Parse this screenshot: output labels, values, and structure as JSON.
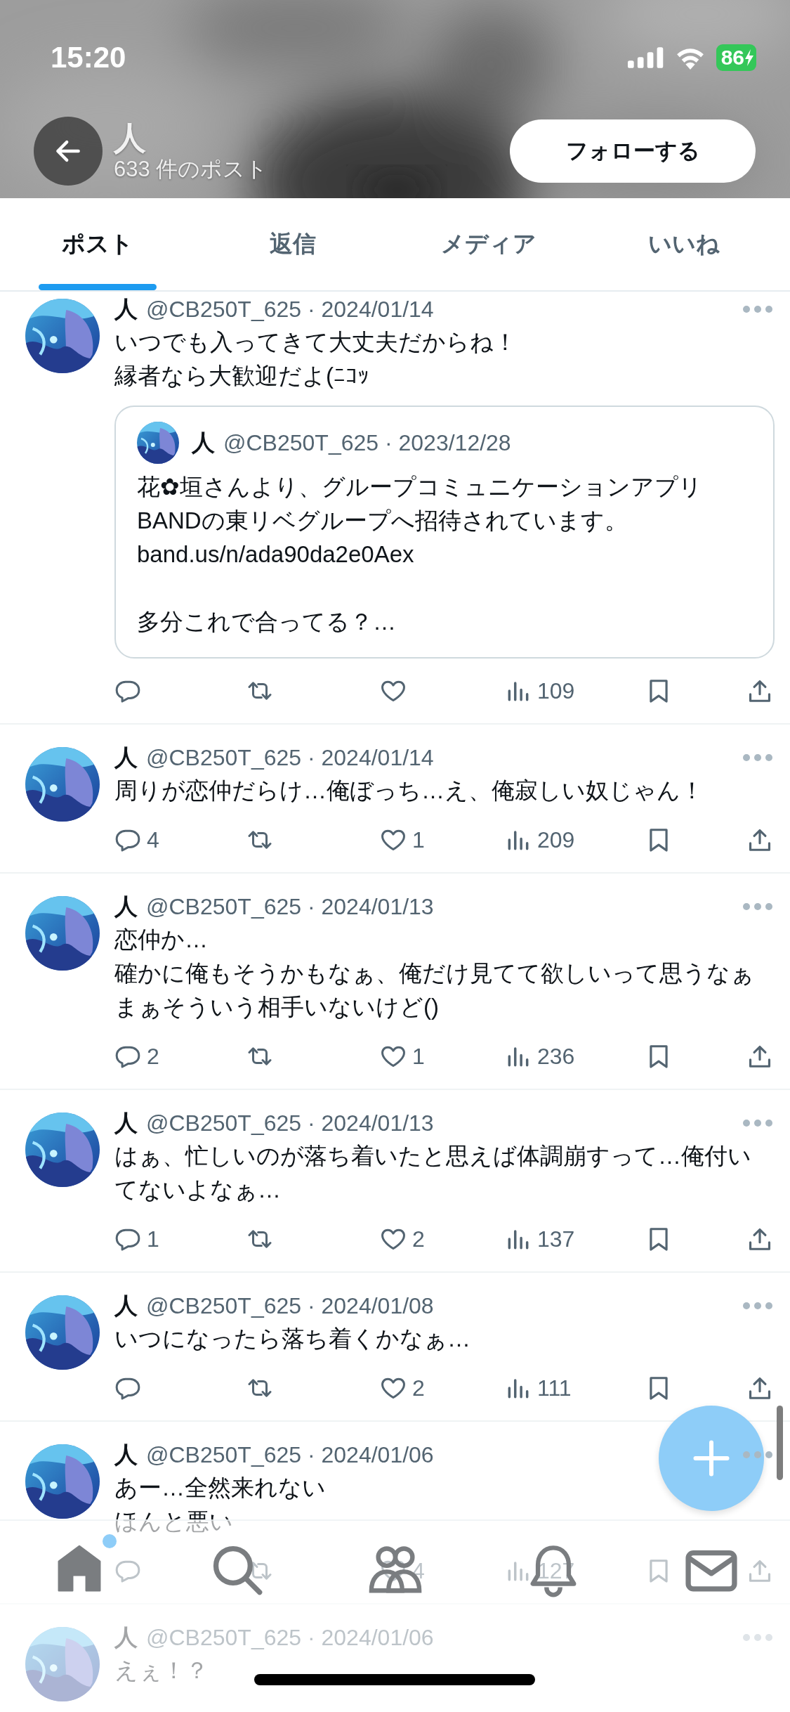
{
  "status_bar": {
    "time": "15:20",
    "battery": "86",
    "charging": true
  },
  "header": {
    "name": "人",
    "post_count": "633 件のポスト",
    "follow_button": "フォローする"
  },
  "tabs": [
    {
      "label": "ポスト",
      "selected": true
    },
    {
      "label": "返信",
      "selected": false
    },
    {
      "label": "メディア",
      "selected": false
    },
    {
      "label": "いいね",
      "selected": false
    }
  ],
  "posts": [
    {
      "name": "人",
      "byline": "@CB250T_625 · 2024/01/14",
      "paragraphs": [
        [
          "いつでも入ってきて大丈夫だからね！",
          "縁者なら大歓迎だよ(ﾆｺｯ"
        ]
      ],
      "quote": {
        "name": "人",
        "byline": "@CB250T_625 · 2023/12/28",
        "paragraphs": [
          [
            "花✿垣さんより、グループコミュニケーションアプリBANDの東リベグループへ招待されています。",
            "band.us/n/ada90da2e0Aex"
          ],
          [
            "多分これで合ってる？…"
          ]
        ]
      },
      "actions": {
        "views": "109"
      }
    },
    {
      "name": "人",
      "byline": "@CB250T_625 · 2024/01/14",
      "paragraphs": [
        [
          "周りが恋仲だらけ…俺ぼっち…え、俺寂しい奴じゃん！"
        ]
      ],
      "actions": {
        "replies": "4",
        "likes": "1",
        "views": "209"
      }
    },
    {
      "name": "人",
      "byline": "@CB250T_625 · 2024/01/13",
      "paragraphs": [
        [
          "恋仲か…",
          "確かに俺もそうかもなぁ、俺だけ見てて欲しいって思うなぁ",
          "まぁそういう相手いないけど()"
        ]
      ],
      "actions": {
        "replies": "2",
        "likes": "1",
        "views": "236"
      }
    },
    {
      "name": "人",
      "byline": "@CB250T_625 · 2024/01/13",
      "paragraphs": [
        [
          "はぁ、忙しいのが落ち着いたと思えば体調崩すって…俺付いてないよなぁ…"
        ]
      ],
      "actions": {
        "replies": "1",
        "likes": "2",
        "views": "137"
      }
    },
    {
      "name": "人",
      "byline": "@CB250T_625 · 2024/01/08",
      "paragraphs": [
        [
          "いつになったら落ち着くかなぁ…"
        ]
      ],
      "actions": {
        "likes": "2",
        "views": "111"
      }
    },
    {
      "name": "人",
      "byline": "@CB250T_625 · 2024/01/06",
      "paragraphs": [
        [
          "あー…全然来れない",
          "ほんと悪い"
        ]
      ],
      "actions": {
        "likes": "4",
        "views": "127"
      }
    },
    {
      "name": "人",
      "byline": "@CB250T_625 · 2024/01/06",
      "paragraphs": [
        [
          "えぇ！？"
        ]
      ]
    }
  ],
  "nav": [
    {
      "kind": "home",
      "selected": true,
      "badge": true
    },
    {
      "kind": "search",
      "selected": false
    },
    {
      "kind": "communities",
      "selected": false
    },
    {
      "kind": "notifications",
      "selected": false
    },
    {
      "kind": "messages",
      "selected": false
    }
  ]
}
